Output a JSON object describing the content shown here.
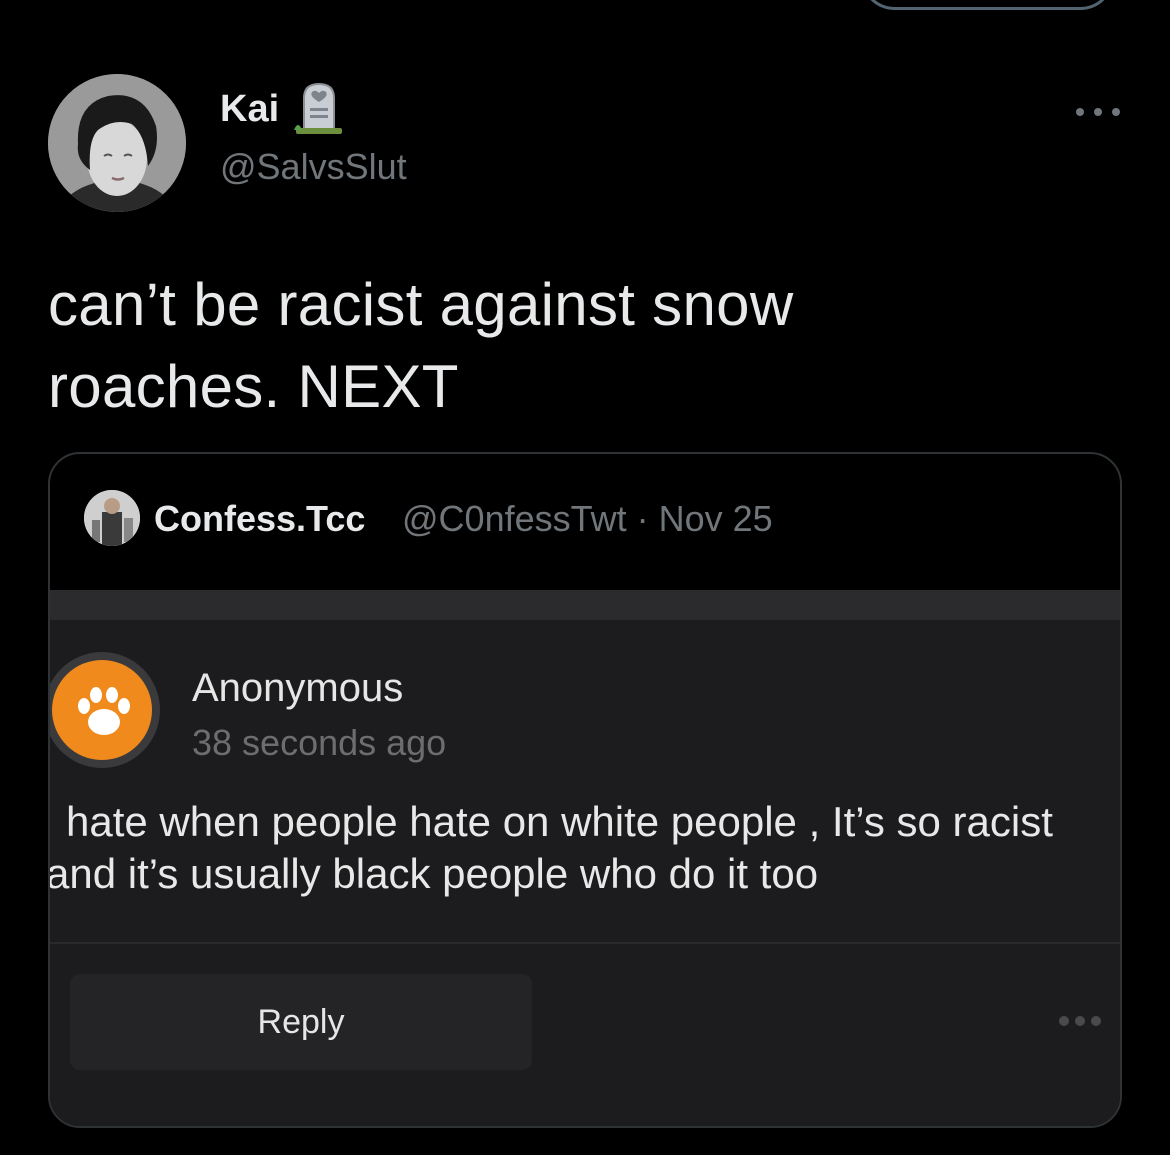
{
  "tweet": {
    "author": {
      "display_name": "Kai",
      "handle": "@SalvsSlut"
    },
    "text_line_1": "can’t be racist against snow",
    "text_line_2": "roaches. NEXT"
  },
  "quote": {
    "author_name": "Confess.Tcc",
    "author_handle_date": "@C0nfessTwt · Nov 25",
    "embedded_post": {
      "author": "Anonymous",
      "time": "38 seconds ago",
      "text_line_1": "hate when people hate on white people , It’s so racist",
      "text_line_2": "and it’s usually black people who do it too",
      "reply_label": "Reply"
    }
  },
  "colors": {
    "background": "#000000",
    "primary_text": "#e7e9ea",
    "secondary_text": "#71767b",
    "anon_avatar_orange": "#f08a1c"
  },
  "icons": [
    "tombstone-icon",
    "more-options-icon",
    "paw-icon",
    "ellipsis-icon"
  ]
}
